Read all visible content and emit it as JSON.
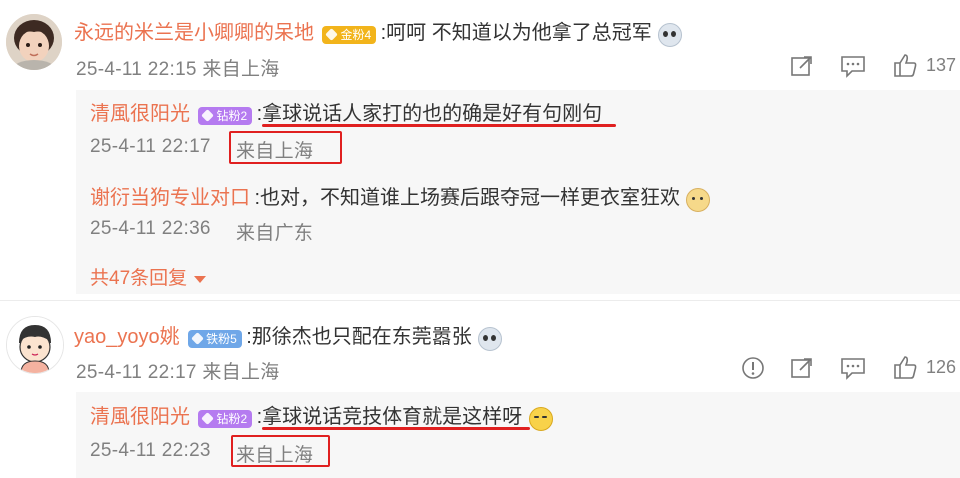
{
  "comments": [
    {
      "user": "永远的米兰是小卿卿的呆地",
      "badge": "金粉4",
      "text": ":呵呵 不知道以为他拿了总冠军",
      "meta": "25-4-11 22:15 来自上海",
      "like_count": "137",
      "replies": [
        {
          "user": "清風很阳光",
          "badge": "钻粉2",
          "text": ":拿球说话人家打的也的确是好有句刚句",
          "time": "25-4-11 22:17",
          "location": "来自上海"
        },
        {
          "user": "谢衍当狗专业对口",
          "text": ":也对，不知道谁上场赛后跟夺冠一样更衣室狂欢",
          "time": "25-4-11 22:36",
          "location": "来自广东"
        }
      ],
      "more_replies": "共47条回复"
    },
    {
      "user": "yao_yoyo姚",
      "badge": "铁粉5",
      "text": ":那徐杰也只配在东莞嚣张",
      "meta": "25-4-11 22:17 来自上海",
      "like_count": "126",
      "replies": [
        {
          "user": "清風很阳光",
          "badge": "钻粉2",
          "text": ":拿球说话竞技体育就是这样呀",
          "time": "25-4-11 22:23",
          "location": "来自上海"
        }
      ]
    }
  ],
  "colors": {
    "username": "#eb7350",
    "highlight": "#e02020",
    "meta": "#808080"
  }
}
